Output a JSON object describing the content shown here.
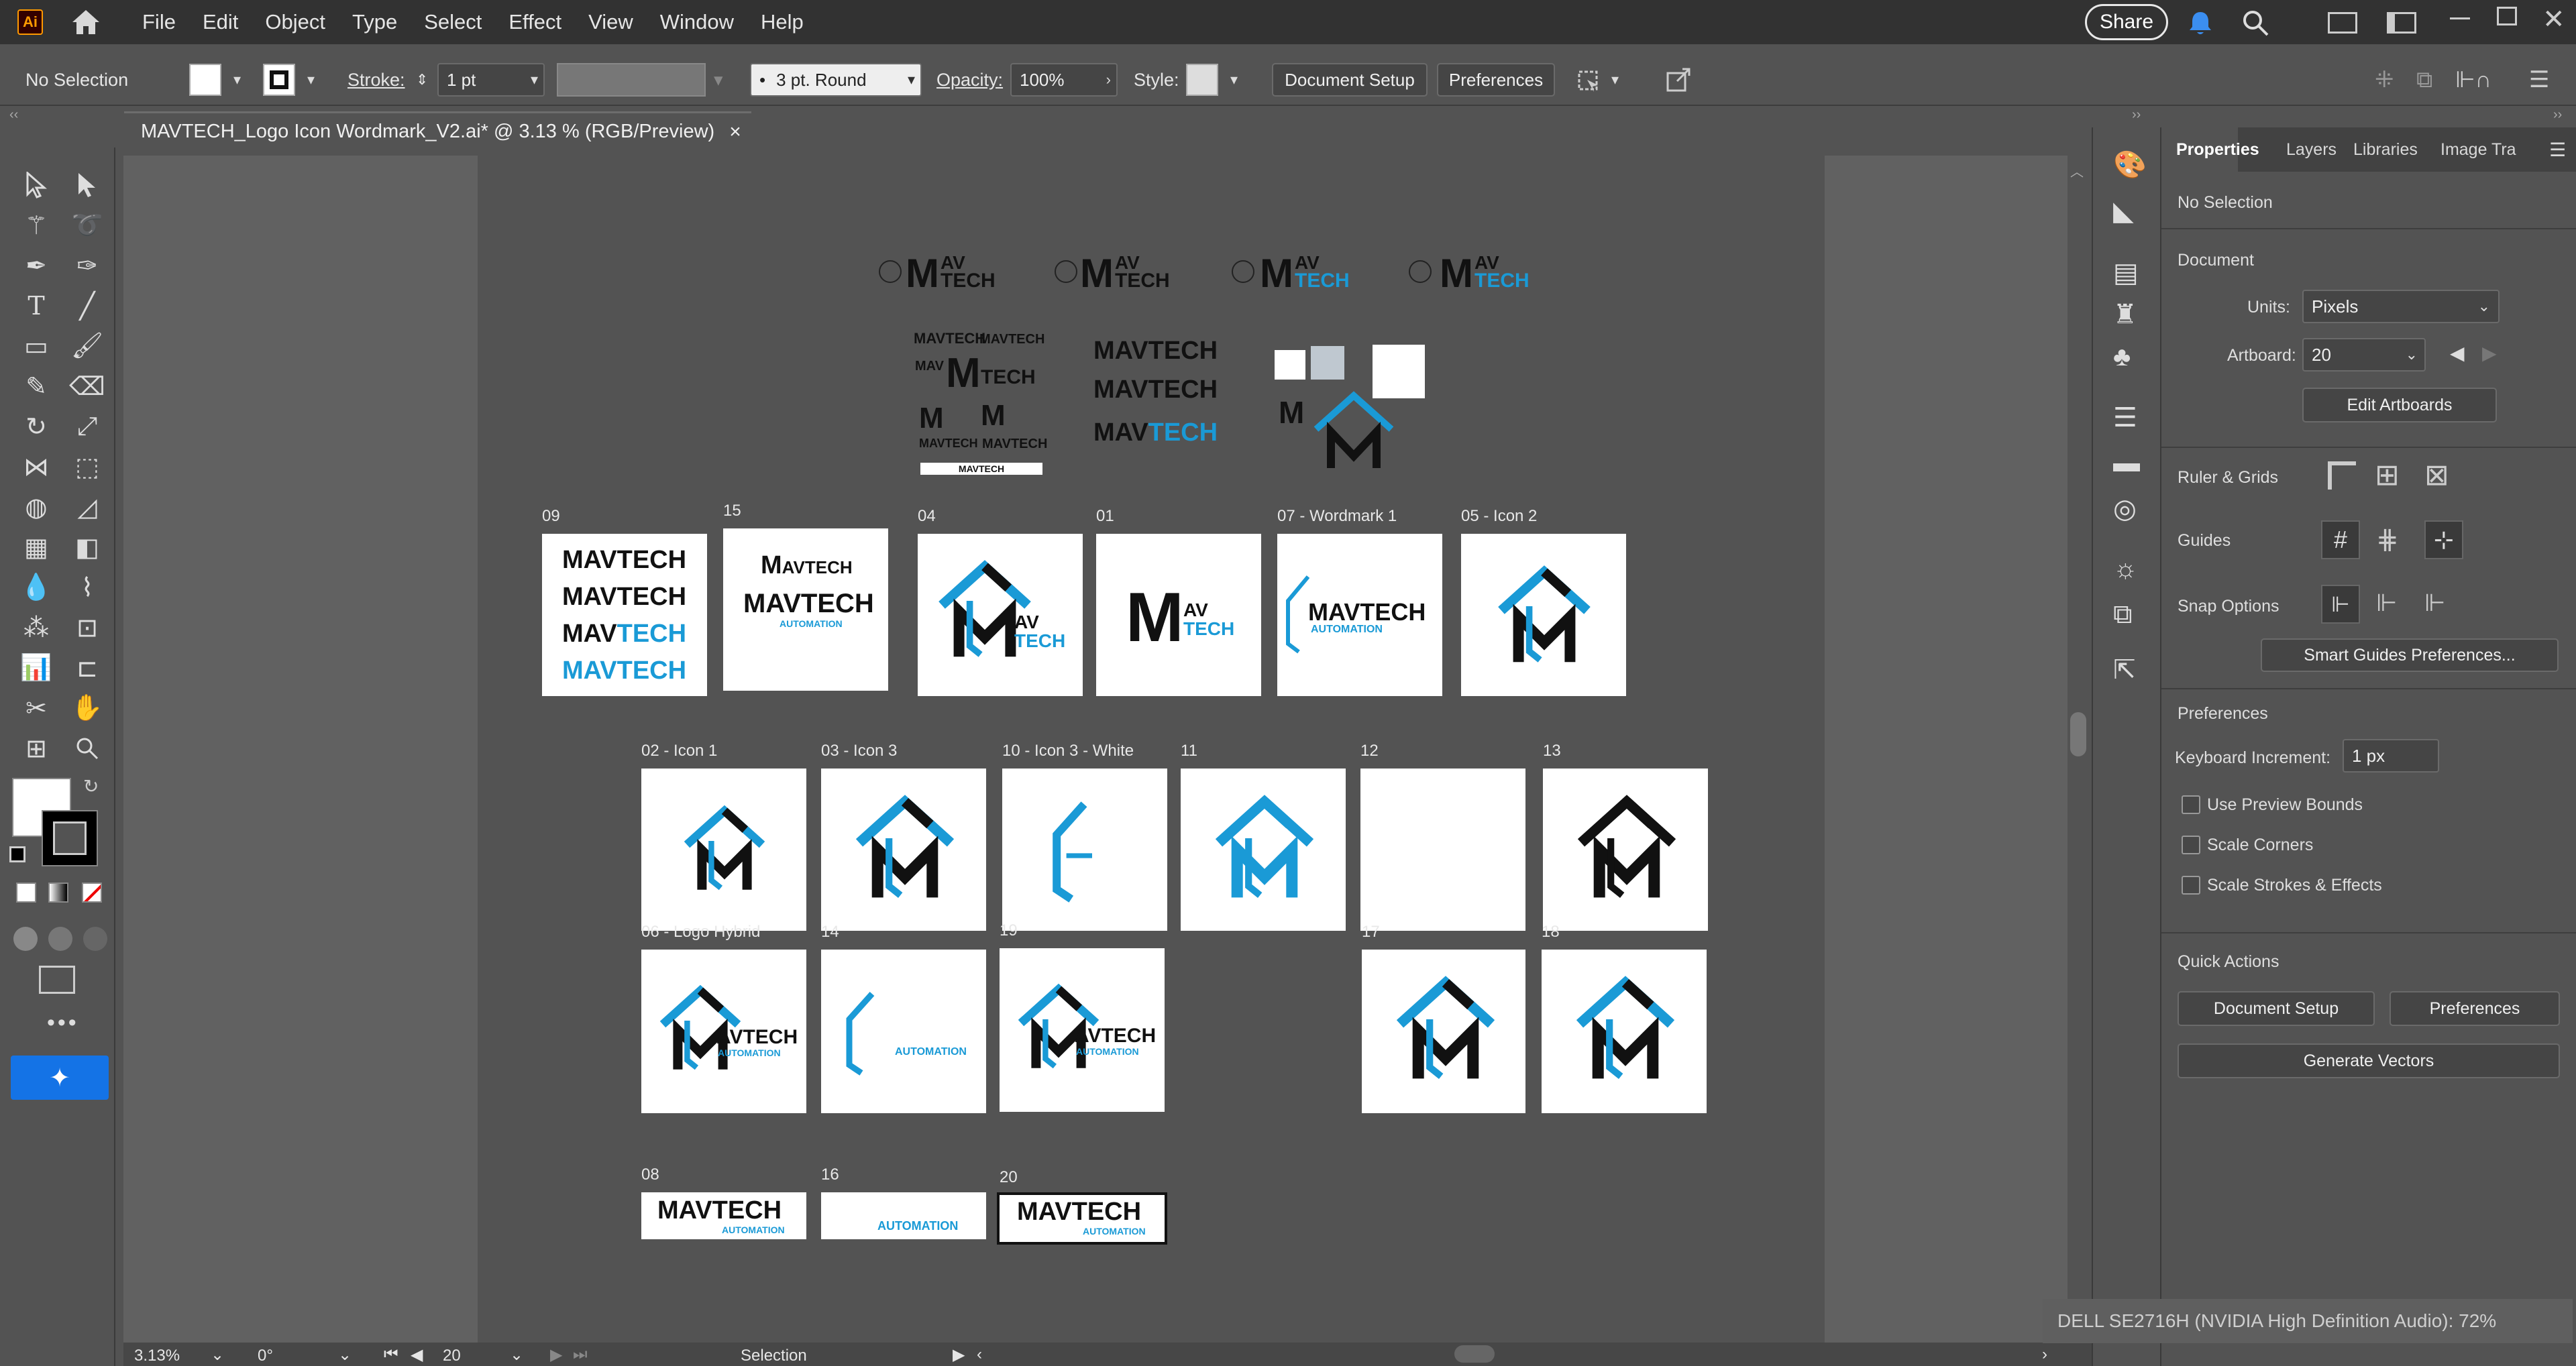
{
  "app": {
    "logo": "Ai",
    "home_icon": "home-icon"
  },
  "menu": [
    "File",
    "Edit",
    "Object",
    "Type",
    "Select",
    "Effect",
    "View",
    "Window",
    "Help"
  ],
  "header_right": {
    "share_label": "Share"
  },
  "control_bar": {
    "selection_status": "No Selection",
    "stroke_label": "Stroke:",
    "stroke_value": "1 pt",
    "brush_value": "3 pt. Round",
    "opacity_label": "Opacity:",
    "opacity_value": "100%",
    "style_label": "Style:",
    "document_setup": "Document Setup",
    "preferences": "Preferences"
  },
  "document_tab": {
    "title": "MAVTECH_Logo Icon Wordmark_V2.ai* @ 3.13 % (RGB/Preview)",
    "close": "×"
  },
  "artboards": {
    "row1": [
      {
        "label": "09"
      },
      {
        "label": "15"
      },
      {
        "label": "04"
      },
      {
        "label": "01"
      },
      {
        "label": "07 - Wordmark 1"
      },
      {
        "label": "05 - Icon 2"
      }
    ],
    "row2": [
      {
        "label": "02 - Icon 1"
      },
      {
        "label": "03 - Icon 3"
      },
      {
        "label": "10 - Icon 3 - White"
      },
      {
        "label": "11"
      },
      {
        "label": "12"
      },
      {
        "label": "13"
      }
    ],
    "row3": [
      {
        "label": "06 - Logo Hybrid"
      },
      {
        "label": "14"
      },
      {
        "label": "19"
      },
      {
        "label": "17"
      },
      {
        "label": "18"
      }
    ],
    "row4": [
      {
        "label": "08"
      },
      {
        "label": "16"
      },
      {
        "label": "20"
      }
    ]
  },
  "wordmark": {
    "mav": "MAV",
    "tech": "TECH",
    "mavtech": "MAVTECH",
    "automation": "AUTOMATION",
    "automation_title": "Automation",
    "m": "M",
    "av": "AV"
  },
  "colors": {
    "brand_blue": "#1a9ad6",
    "brand_black": "#111111",
    "accent": "#1473e6"
  },
  "properties": {
    "tabs": [
      "Properties",
      "Layers",
      "Libraries",
      "Image Tra"
    ],
    "no_selection": "No Selection",
    "document_title": "Document",
    "units_label": "Units:",
    "units_value": "Pixels",
    "artboard_label": "Artboard:",
    "artboard_value": "20",
    "edit_artboards": "Edit Artboards",
    "ruler_grids": "Ruler & Grids",
    "guides": "Guides",
    "snap_options": "Snap Options",
    "smart_guides": "Smart Guides Preferences...",
    "preferences_title": "Preferences",
    "keyboard_increment_label": "Keyboard Increment:",
    "keyboard_increment_value": "1 px",
    "checks": [
      "Use Preview Bounds",
      "Scale Corners",
      "Scale Strokes & Effects"
    ],
    "quick_actions": "Quick Actions",
    "document_setup": "Document Setup",
    "preferences": "Preferences",
    "generate_vectors": "Generate Vectors"
  },
  "status": {
    "zoom": "3.13%",
    "rotation": "0°",
    "artboard": "20",
    "tool": "Selection"
  },
  "toast": "DELL SE2716H (NVIDIA High Definition Audio): 72%"
}
